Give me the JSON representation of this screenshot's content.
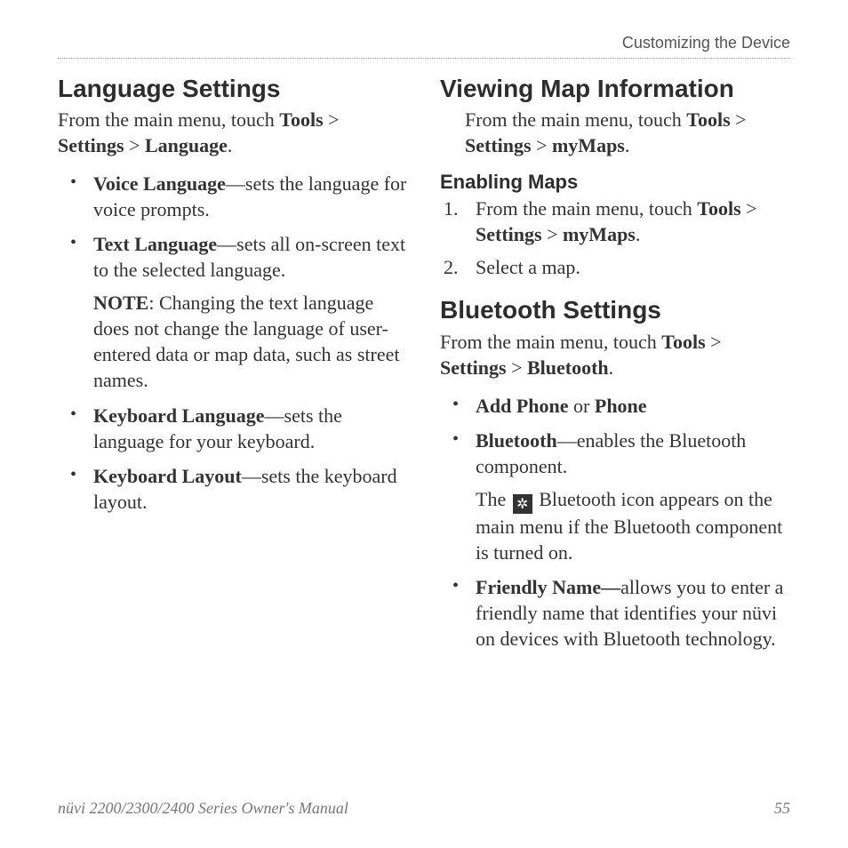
{
  "header": "Customizing the Device",
  "left": {
    "h_lang": "Language Settings",
    "lang_intro_a": "From the main menu, touch ",
    "tools": "Tools",
    "gt": " > ",
    "settings": "Settings",
    "language": "Language",
    "period": ".",
    "voice_b": "Voice Language",
    "voice_t": "—sets the language for voice prompts.",
    "text_b": "Text Language",
    "text_t": "—sets all on-screen text to the selected language.",
    "note_b": "NOTE",
    "note_t": ": Changing the text language does not change the language of user-entered data or map data, such as street names.",
    "kbl_b": "Keyboard Language",
    "kbl_t": "—sets the language for your keyboard.",
    "kly_b": "Keyboard Layout",
    "kly_t": "—sets the keyboard layout."
  },
  "right": {
    "h_map": "Viewing Map Information",
    "map_intro_a": "From the main menu, touch ",
    "tools": "Tools",
    "gt": " > ",
    "settings": "Settings",
    "mymaps": "myMaps",
    "period": ".",
    "h_enable": "Enabling Maps",
    "step1_a": "From the main menu, touch ",
    "step2": "Select a map.",
    "h_bt": "Bluetooth Settings",
    "bt_intro_a": "From the main menu, touch ",
    "bluetooth": "Bluetooth",
    "addphone_b": "Add Phone",
    "or": " or ",
    "phone_b": "Phone",
    "bt_b": "Bluetooth",
    "bt_t": "—enables the Bluetooth component.",
    "bt_sub_a": "The ",
    "bt_sub_b": " Bluetooth icon appears on the main menu if the Bluetooth component is turned on.",
    "fn_b": "Friendly Name—",
    "fn_t": "allows you to enter a friendly name that identifies your nüvi on devices with Bluetooth technology."
  },
  "footer": {
    "title": "nüvi 2200/2300/2400 Series Owner's Manual",
    "page": "55"
  }
}
